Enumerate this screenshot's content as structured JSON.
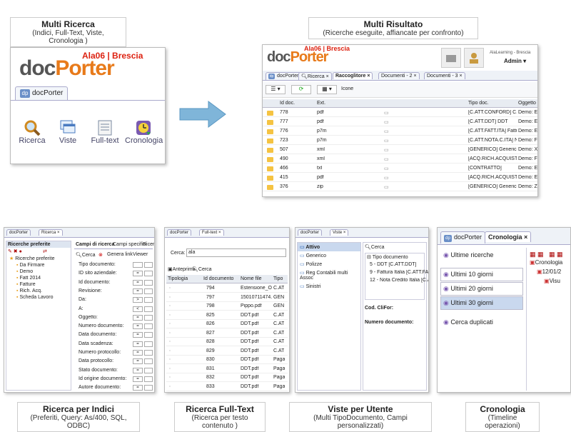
{
  "captions": {
    "multi_ricerca": {
      "title": "Multi Ricerca",
      "sub": "(Indici, Full-Text, Viste, Cronologia )"
    },
    "multi_risultato": {
      "title": "Multi Risultato",
      "sub": "(Ricerche eseguite, affiancate per confronto)"
    },
    "ricerca_indici": {
      "title": "Ricerca per Indici",
      "sub": "(Preferiti, Query: As/400, SQL, ODBC)"
    },
    "ricerca_fulltext": {
      "title": "Ricerca Full-Text",
      "sub": "(Ricerca per testo contenuto )"
    },
    "viste_utente": {
      "title": "Viste per Utente",
      "sub": "(Multi TipoDocumento, Campi personalizzati)"
    },
    "cronologia": {
      "title": "Cronologia",
      "sub": "(Timeline operazioni)"
    }
  },
  "logo": {
    "ala": "Ala06 | Brescia",
    "doc": "doc",
    "porter": "Porter"
  },
  "multi_ricerca_panel": {
    "tab": "docPorter",
    "icons": [
      {
        "label": "Ricerca",
        "icon": "magnifier-icon"
      },
      {
        "label": "Viste",
        "icon": "windows-icon"
      },
      {
        "label": "Full-text",
        "icon": "document-text-icon"
      },
      {
        "label": "Cronologia",
        "icon": "clock-icon"
      }
    ]
  },
  "risultato_panel": {
    "user_company": "AlaLearning - Brescia",
    "user": "Admin",
    "tabs": [
      "docPorter",
      "Ricerca",
      "Raccoglitore",
      "Documenti - 2",
      "Documenti - 3"
    ],
    "toolbar_label": "Icone",
    "headers": {
      "id": "Id doc.",
      "ext": "Ext.",
      "tipo": "Tipo doc.",
      "ogg": "Oggetto"
    },
    "rows": [
      {
        "id": "778",
        "ext": "pdf",
        "tipo": "[C.ATT.CONFORD] C...",
        "ogg": "Demo: Ese"
      },
      {
        "id": "777",
        "ext": "pdf",
        "tipo": "[C.ATT.DDT] DDT",
        "ogg": "Demo: Ese"
      },
      {
        "id": "776",
        "ext": "p7m",
        "tipo": "[C.ATT.FATT.ITA] Fattu...",
        "ogg": "Demo: Ese"
      },
      {
        "id": "723",
        "ext": "p7m",
        "tipo": "[C.ATT.NOTA.C.ITA] N...",
        "ogg": "Demo: Firm"
      },
      {
        "id": "507",
        "ext": "xml",
        "tipo": "[GENERICO] Generico",
        "ogg": "Demo: XMl"
      },
      {
        "id": "490",
        "ext": "xml",
        "tipo": "[ACQ.RICH.ACQUIST...",
        "ogg": "Demo: Fatt"
      },
      {
        "id": "466",
        "ext": "txt",
        "tipo": "[CONTRATTO]",
        "ogg": "Demo: Ese"
      },
      {
        "id": "415",
        "ext": "pdf",
        "tipo": "[ACQ.RICH.ACQUIST...",
        "ogg": "Demo: Ese"
      },
      {
        "id": "376",
        "ext": "zip",
        "tipo": "[GENERICO] Generico",
        "ogg": "Demo: Zip"
      }
    ]
  },
  "indici_panel": {
    "tabs": [
      "docPorter",
      "Ricerca"
    ],
    "pref_title": "Ricerche preferite",
    "tree": [
      "Ricerche preferite",
      "Da Firmare",
      "Demo",
      "Fatt 2014",
      "Fatture",
      "Rich. Acq.",
      "Scheda Lavoro"
    ],
    "subtabs": [
      "Campi di ricerca",
      "Campi specifici",
      "Ricer"
    ],
    "buttons": [
      "Cerca",
      "Genera link",
      "Viewer"
    ],
    "fields": [
      "Tipo documento:",
      "ID sito aziendale:",
      "Id documento:",
      "Revisione:",
      "Da:",
      "A:",
      "Oggetto:",
      "Numero documento:",
      "Data documento:",
      "Data scadenza:",
      "Numero protocollo:",
      "Data protocollo:",
      "Stato documento:",
      "Id origine documento:",
      "Autore documento:"
    ],
    "ops": [
      "",
      "=",
      "=",
      "=",
      ">",
      "<",
      "=",
      "=",
      "=",
      "=",
      "=",
      "=",
      "=",
      "=",
      "="
    ]
  },
  "fulltext_panel": {
    "tabs": [
      "docPorter",
      "Full-text"
    ],
    "search_label": "Cerca:",
    "search_value": "ala",
    "buttons": [
      "Anteprima",
      "Cerca"
    ],
    "headers": [
      "Tipologia",
      "Id documento",
      "Nome file",
      "Tipo"
    ],
    "rows": [
      {
        "id": "794",
        "file": "Estensione_O...",
        "tipo": "C.AT"
      },
      {
        "id": "797",
        "file": "15010711474...",
        "tipo": "GEN"
      },
      {
        "id": "798",
        "file": "Pippo.pdf",
        "tipo": "GEN"
      },
      {
        "id": "825",
        "file": "DDT.pdf",
        "tipo": "C.AT"
      },
      {
        "id": "826",
        "file": "DDT.pdf",
        "tipo": "C.AT"
      },
      {
        "id": "827",
        "file": "DDT.pdf",
        "tipo": "C.AT"
      },
      {
        "id": "828",
        "file": "DDT.pdf",
        "tipo": "C.AT"
      },
      {
        "id": "829",
        "file": "DDT.pdf",
        "tipo": "C.AT"
      },
      {
        "id": "830",
        "file": "DDT.pdf",
        "tipo": "Paga"
      },
      {
        "id": "831",
        "file": "DDT.pdf",
        "tipo": "Paga"
      },
      {
        "id": "832",
        "file": "DDT.pdf",
        "tipo": "Paga"
      },
      {
        "id": "833",
        "file": "DDT.pdf",
        "tipo": "Paga"
      }
    ]
  },
  "viste_panel": {
    "tabs": [
      "docPorter",
      "Viste"
    ],
    "list": [
      "Attivo",
      "Generico",
      "Polizze",
      "Reg Contabili multi Assoc",
      "Sinistri"
    ],
    "cerca": "Cerca",
    "group": "Tipo documento",
    "types": [
      "5 - DDT [C.ATT.DDT]",
      "9 - Fattura Italia [C.ATT.FATT.I",
      "12 - Nota Credito Italia [C.ATT."
    ],
    "fields": [
      "Cod. CliFor:",
      "Numero documento:"
    ]
  },
  "cronologia_panel": {
    "tabs": [
      "docPorter",
      "Cronologia"
    ],
    "items": [
      "Ultime ricerche",
      "Ultimi 10 giorni",
      "Ultimi 20 giorni",
      "Ultimi 30 giorni",
      "Cerca duplicati"
    ],
    "tree": [
      "Cronologia",
      "12/01/2",
      "Visu"
    ]
  },
  "colors": {
    "accent": "#e87a1a",
    "brand_red": "#d21",
    "arrow": "#7fb5d9",
    "selected": "#c9d8ee"
  }
}
